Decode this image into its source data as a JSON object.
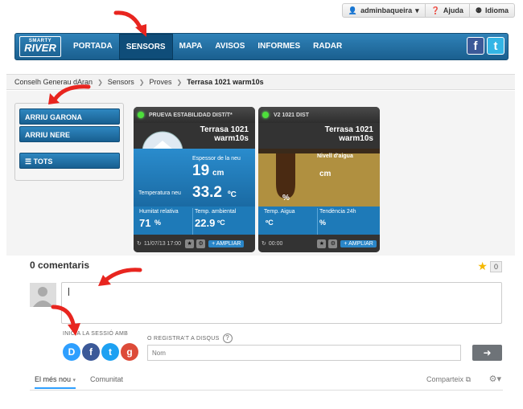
{
  "topmenu": {
    "user": "adminbaqueira",
    "help": "Ajuda",
    "language": "Idioma"
  },
  "brand": {
    "logo_top": "SMARTY",
    "logo_main": "RIVER"
  },
  "nav": {
    "items": [
      "PORTADA",
      "SENSORS",
      "MAPA",
      "AVISOS",
      "INFORMES",
      "RADAR"
    ],
    "active": "SENSORS"
  },
  "social": {
    "facebook": "f",
    "twitter": "t"
  },
  "breadcrumb": {
    "items": [
      "Conselh Generau dAran",
      "Sensors",
      "Proves"
    ],
    "current": "Terrasa 1021 warm10s"
  },
  "sidebar": {
    "items": [
      "ARRIU GARONA",
      "ARRIU NERE"
    ],
    "all": "TOTS"
  },
  "cards": [
    {
      "header": "PRUEVA ESTABILIDAD DIST/T*",
      "name_line1": "Terrasa 1021",
      "name_line2": "warm10s",
      "snow_label": "Espessor de la neu",
      "snow_value": "19",
      "snow_unit": "cm",
      "temp_label": "Temperatura neu",
      "temp_value": "33.2",
      "temp_unit": "ºC",
      "hum_label": "Humitat relativa",
      "hum_value": "71",
      "hum_unit": "%",
      "amb_label": "Temp. ambiental",
      "amb_value": "22.9",
      "amb_unit": "ºC",
      "time": "11/07/13 17:00",
      "ampliar": "AMPLIAR"
    },
    {
      "header": "V2 1021 DIST",
      "name_line1": "Terrasa 1021",
      "name_line2": "warm10s",
      "water_label": "Nivell d'aigua",
      "water_unit": "cm",
      "pct_unit": "%",
      "water_temp_label": "Temp. Aigua",
      "water_temp_unit": "ºC",
      "trend_label": "Tendència 24h",
      "trend_unit": "%",
      "time": "00:00",
      "ampliar": "AMPLIAR"
    }
  ],
  "comments": {
    "title": "0 comentaris",
    "star_count": "0",
    "login_label": "INICIA LA SESSIÓ AMB",
    "register_label": "O REGISTRA'T A DISQUS",
    "name_placeholder": "Nom",
    "tab_best": "El més nou",
    "tab_community": "Comunitat",
    "share": "Comparteix"
  },
  "colors": {
    "nav_blue": "#1f6ea3",
    "card_blue": "#1e7ab8",
    "arrow_red": "#e8251f"
  }
}
